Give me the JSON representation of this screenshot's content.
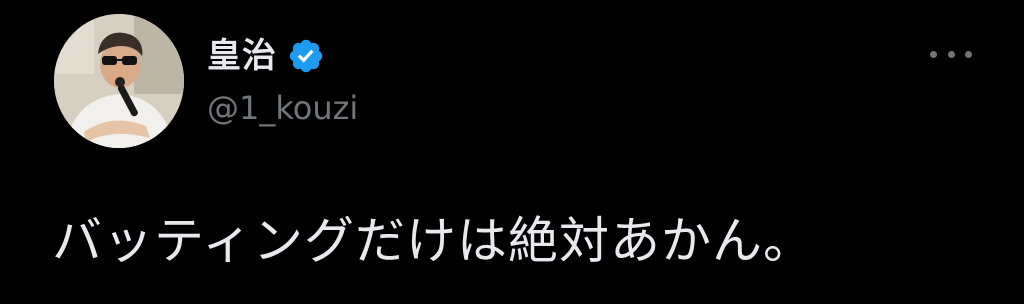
{
  "author": {
    "display_name": "皇治",
    "handle": "@1_kouzi",
    "verified": true,
    "verified_color": "#1d9bf0"
  },
  "tweet": {
    "text": "バッティングだけは絶対あかん。"
  },
  "icons": {
    "more": "more-horizontal-icon",
    "verified": "verified-badge-icon"
  },
  "colors": {
    "background": "#000000",
    "primary_text": "#e7e9ea",
    "secondary_text": "#71767b"
  }
}
